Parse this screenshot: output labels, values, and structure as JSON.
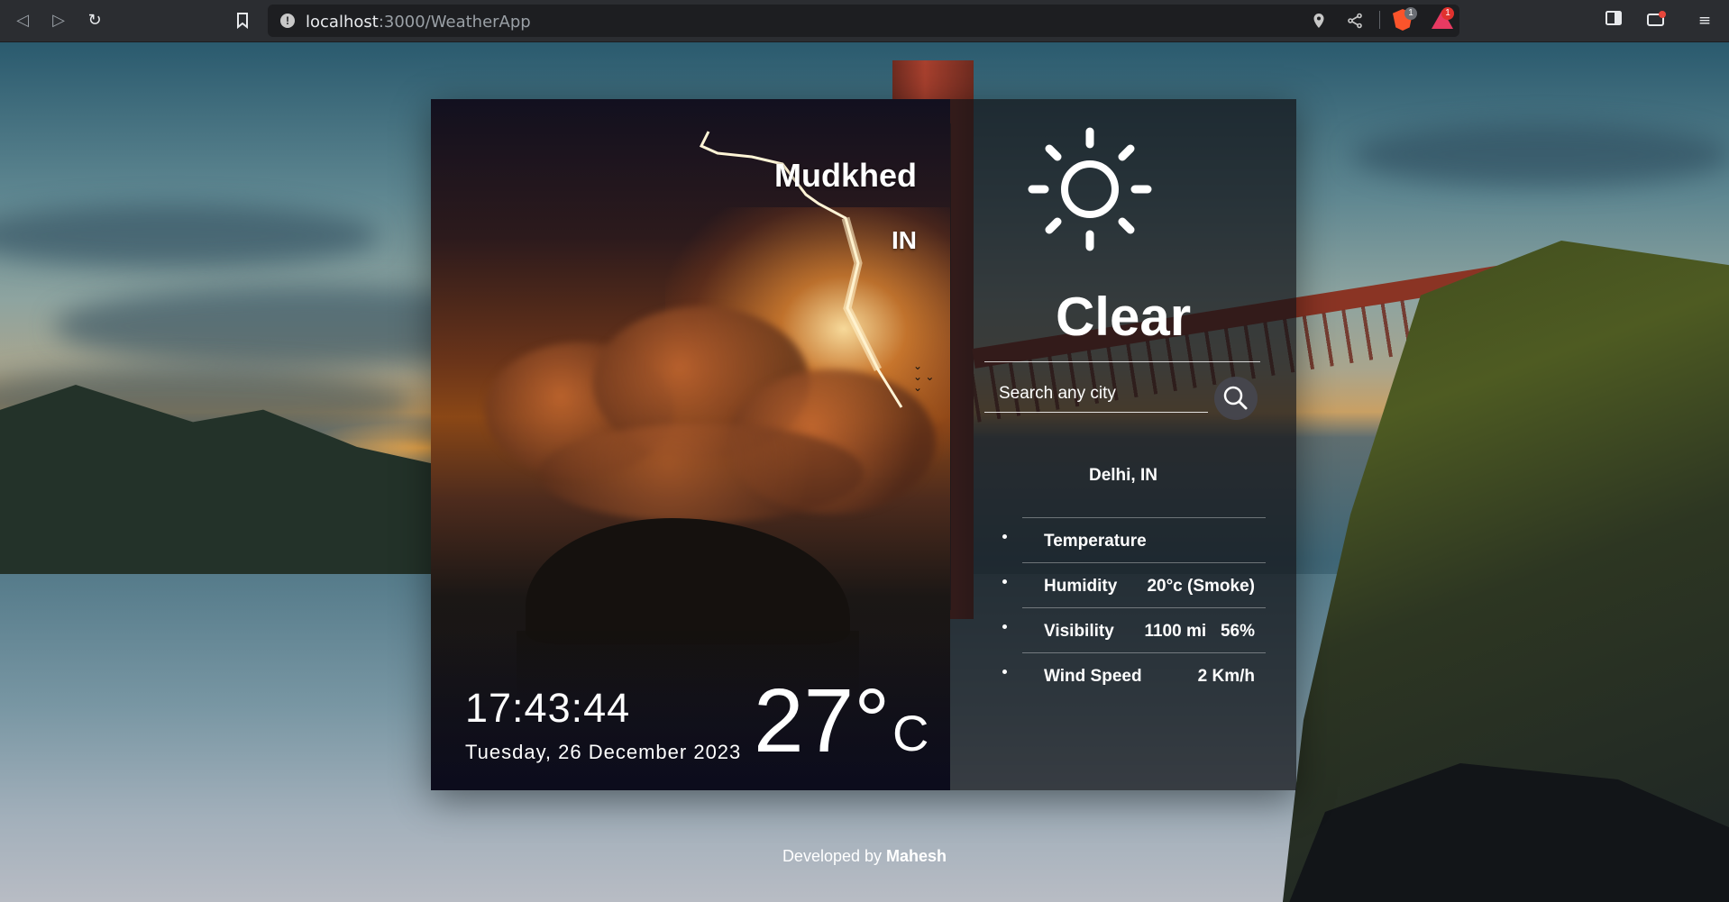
{
  "browser": {
    "url_host": "localhost",
    "url_path": ":3000/WeatherApp",
    "brave_shields_count": "1",
    "rewards_count": "1"
  },
  "weather": {
    "city": "Mudkhed",
    "country": "IN",
    "time": "17:43:44",
    "date": "Tuesday, 26 December 2023",
    "temperature": "27°",
    "unit": "C",
    "condition": "Clear",
    "condition_icon": "sun-icon"
  },
  "search": {
    "placeholder": "Search any city",
    "location": "Delhi, IN",
    "details": [
      {
        "label": "Temperature",
        "value": ""
      },
      {
        "label": "Humidity",
        "value": "20°c (Smoke)"
      },
      {
        "label": "Visibility",
        "value": "1100 mi   56%"
      },
      {
        "label": "Wind Speed",
        "value": "2 Km/h"
      }
    ]
  },
  "footer": {
    "prefix": "Developed by ",
    "author": "Mahesh"
  },
  "colors": {
    "browser_chrome": "#2b2d31",
    "urlbar": "#1d1e21",
    "panel_overlay": "#121216",
    "text": "#ffffff"
  }
}
